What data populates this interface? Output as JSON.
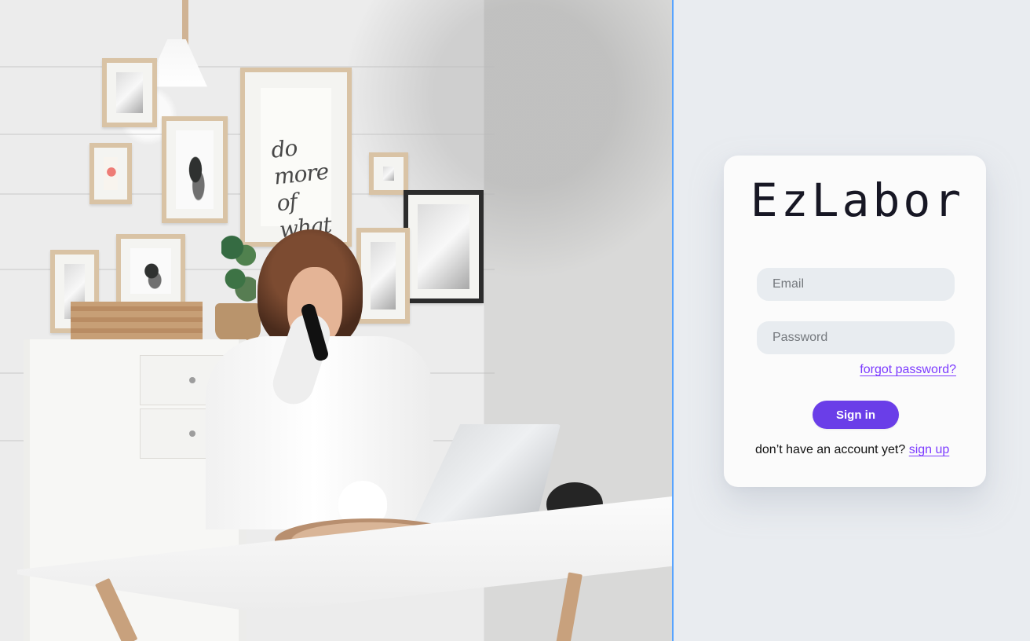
{
  "brand": {
    "name": "EzLabor"
  },
  "login": {
    "email_placeholder": "Email",
    "password_placeholder": "Password",
    "forgot_password_label": "forgot password?",
    "sign_in_label": "Sign in",
    "signup_prompt": "don’t have an account yet?",
    "signup_label": "sign up"
  },
  "hero": {
    "art_text": "do more of what make you happy"
  },
  "colors": {
    "accent": "#6a3ee8",
    "link": "#7c3bff",
    "divider": "#58a4ff",
    "field_background": "#e8ecf0",
    "page_background": "#e9ecf0"
  },
  "icons": {
    "hero_image": "workspace-photo"
  }
}
